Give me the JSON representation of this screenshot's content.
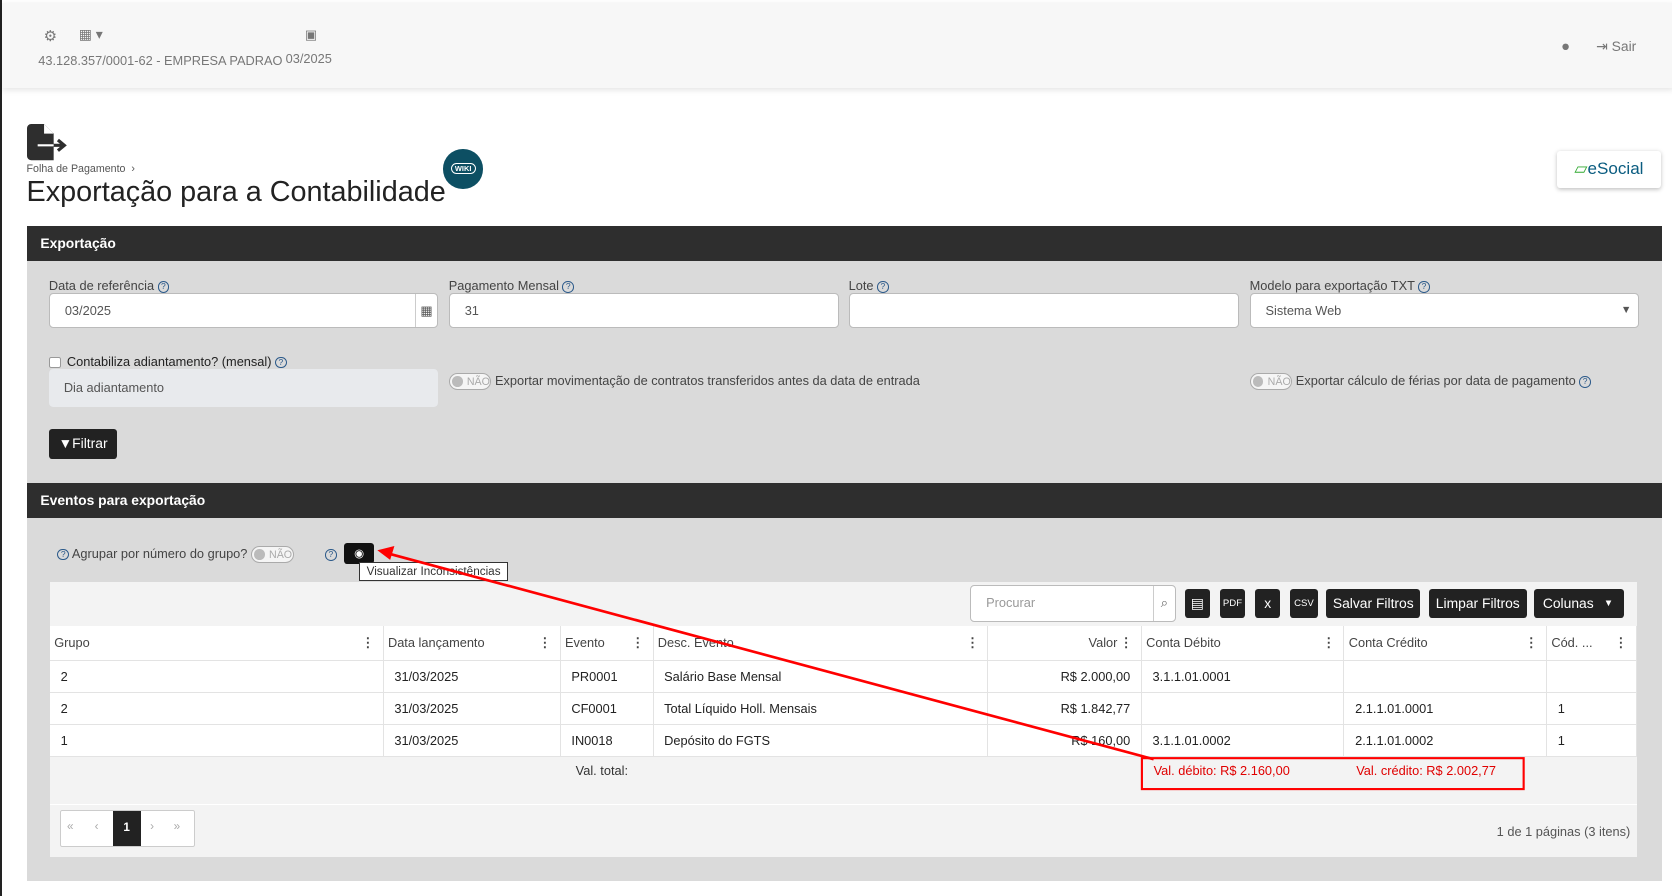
{
  "header": {
    "company": "43.128.357/0001-62 - EMPRESA PADRAO",
    "period": "03/2025",
    "logout": "Sair"
  },
  "page": {
    "breadcrumb": "Folha de Pagamento",
    "title": "Exportação para a Contabilidade",
    "wiki": "WIKI",
    "esocial": "eSocial"
  },
  "export": {
    "title": "Exportação",
    "date_label": "Data de referência",
    "date_value": "03/2025",
    "payment_label": "Pagamento Mensal",
    "payment_value": "31",
    "lote_label": "Lote",
    "lote_value": "",
    "model_label": "Modelo para exportação TXT",
    "model_value": "Sistema Web",
    "advance_label": "Contabiliza adiantamento? (mensal)",
    "advance_placeholder": "Dia adiantamento",
    "transfer_toggle": "NÃO",
    "transfer_label": "Exportar movimentação de contratos transferidos antes da data de entrada",
    "vacation_toggle": "NÃO",
    "vacation_label": "Exportar cálculo de férias por data de pagamento",
    "filter_button": "Filtrar"
  },
  "events": {
    "title": "Eventos para exportação",
    "group_label": "Agrupar por número do grupo?",
    "group_toggle": "NÃO",
    "tooltip": "Visualizar Inconsistências",
    "search_placeholder": "Procurar",
    "save_filters": "Salvar Filtros",
    "clear_filters": "Limpar Filtros",
    "columns": "Colunas",
    "headers": [
      "Grupo",
      "Data lançamento",
      "Evento",
      "Desc. Evento",
      "Valor",
      "Conta Débito",
      "Conta Crédito",
      "Cód. ..."
    ],
    "rows": [
      [
        "2",
        "31/03/2025",
        "PR0001",
        "Salário Base Mensal",
        "R$ 2.000,00",
        "3.1.1.01.0001",
        "",
        ""
      ],
      [
        "2",
        "31/03/2025",
        "CF0001",
        "Total Líquido Holl. Mensais",
        "R$ 1.842,77",
        "",
        "2.1.1.01.0001",
        "1"
      ],
      [
        "1",
        "31/03/2025",
        "IN0018",
        "Depósito do FGTS",
        "R$ 160,00",
        "3.1.1.01.0002",
        "2.1.1.01.0002",
        "1"
      ]
    ],
    "total_label": "Val. total:",
    "total_debit": "Val. débito: R$ 2.160,00",
    "total_credit": "Val. crédito: R$ 2.002,77",
    "page": "1",
    "page_info": "1 de 1 páginas (3 itens)"
  },
  "colors": {
    "dark": "#2e2e2e",
    "panel": "#dadada",
    "annotation": "#ff0000",
    "total": "#e00000"
  }
}
